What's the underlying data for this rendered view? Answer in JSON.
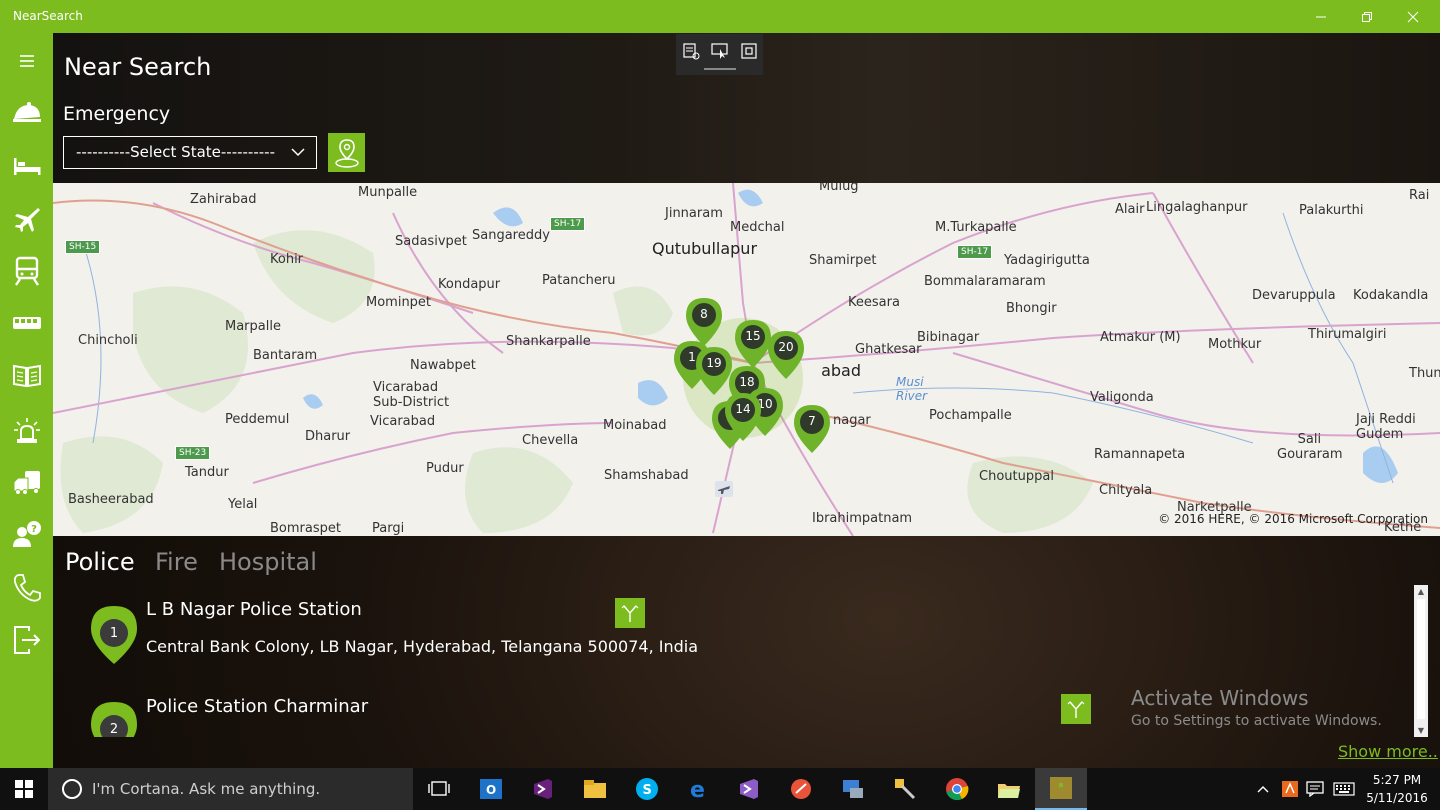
{
  "window": {
    "title": "NearSearch",
    "controls": [
      "minimize",
      "maximize",
      "close"
    ]
  },
  "sidebar": {
    "items": [
      {
        "name": "menu",
        "icon": "hamburger-icon"
      },
      {
        "name": "restaurant",
        "icon": "food-cover-icon"
      },
      {
        "name": "hotel",
        "icon": "bed-icon"
      },
      {
        "name": "airport",
        "icon": "airplane-icon"
      },
      {
        "name": "train",
        "icon": "train-icon"
      },
      {
        "name": "bus",
        "icon": "bus-icon"
      },
      {
        "name": "library",
        "icon": "book-icon"
      },
      {
        "name": "emergency",
        "icon": "siren-icon"
      },
      {
        "name": "transport",
        "icon": "vehicles-icon"
      },
      {
        "name": "help",
        "icon": "person-question-icon"
      },
      {
        "name": "contact",
        "icon": "phone-icon"
      },
      {
        "name": "exit",
        "icon": "exit-icon"
      }
    ]
  },
  "header": {
    "title": "Near Search",
    "section": "Emergency",
    "state_select": "----------Select State----------"
  },
  "map": {
    "copyright": "© 2016 HERE, © 2016 Microsoft Corporation",
    "labels": {
      "zahirabad": "Zahirabad",
      "munpalle": "Munpalle",
      "mulug": "Mulug",
      "jinnaram": "Jinnaram",
      "medchal": "Medchal",
      "mturkapalle": "M.Turkapalle",
      "alair": "Alair",
      "lingalaghanpur": "Lingalaghanpur",
      "palakurthi": "Palakurthi",
      "rai": "Rai",
      "sadasivpet": "Sadasivpet",
      "sangareddy": "Sangareddy",
      "qutubullapur": "Qutubullapur",
      "shamirpet": "Shamirpet",
      "yadagirigutta": "Yadagirigutta",
      "kohir": "Kohir",
      "kondapur": "Kondapur",
      "patancheru": "Patancheru",
      "bommalaramaram": "Bommalaramaram",
      "devaruppula": "Devaruppula",
      "kodakandla": "Kodakandla",
      "mominpet": "Mominpet",
      "keesara": "Keesara",
      "bhongir": "Bhongir",
      "marpalle": "Marpalle",
      "chincholi": "Chincholi",
      "shankarpalle": "Shankarpalle",
      "bibinagar": "Bibinagar",
      "atmakur": "Atmakur (M)",
      "mothkur": "Mothkur",
      "thirumalgiri": "Thirumalgiri",
      "bantaram": "Bantaram",
      "ghatkesar": "Ghatkesar",
      "nawabpet": "Nawabpet",
      "hyderabad": "Hyderabad",
      "thungathurthi": "Thunga",
      "vicarabad_sub": "Vicarabad\nSub-District",
      "musi_river": "Musi\nRiver",
      "valigonda": "Valigonda",
      "peddemul": "Peddemul",
      "vicarabad": "Vicarabad",
      "moinabad": "Moinabad",
      "pochampalle": "Pochampalle",
      "jaji_reddi": "Jaji Reddi\nGudem",
      "dharur": "Dharur",
      "chevella": "Chevella",
      "lb_nagar": "nagar",
      "sali_gouraram": "Sali\nGouraram",
      "tandur": "Tandur",
      "pudur": "Pudur",
      "ramannapeta": "Ramannapeta",
      "shamshabad": "Shamshabad",
      "choutuppal": "Choutuppal",
      "basheerabad": "Basheerabad",
      "yelal": "Yelal",
      "chityala": "Chityala",
      "narketpalle": "Narketpalle",
      "bomraspet": "Bomraspet",
      "pargi": "Pargi",
      "ibrahimpatnam": "Ibrahimpatnam",
      "kethe": "Kethe"
    },
    "shields": [
      "SH-15",
      "SH-17",
      "SH-17",
      "SH-23"
    ],
    "pins": [
      "8",
      "15",
      "20",
      "19",
      "18",
      "14",
      "10",
      "7",
      "1",
      "9"
    ]
  },
  "tabs": [
    {
      "label": "Police",
      "active": true
    },
    {
      "label": "Fire",
      "active": false
    },
    {
      "label": "Hospital",
      "active": false
    }
  ],
  "results": [
    {
      "index": "1",
      "name": "L B Nagar Police Station",
      "address": "Central Bank Colony, LB Nagar, Hyderabad, Telangana 500074, India"
    },
    {
      "index": "2",
      "name": "Police Station Charminar",
      "address": ""
    }
  ],
  "overlay": {
    "activate_title": "Activate Windows",
    "activate_sub": "Go to Settings to activate Windows.",
    "show_more": "Show more.."
  },
  "taskbar": {
    "search_placeholder": "I'm Cortana. Ask me anything.",
    "apps": [
      "task-view-icon",
      "outlook-icon",
      "visual-studio-icon",
      "file-explorer-icon",
      "skype-icon",
      "edge-icon",
      "visual-studio-purple-icon",
      "app-red-icon",
      "app-network-icon",
      "app-tools-icon",
      "chrome-icon",
      "folder-icon",
      "nearsearch-icon"
    ],
    "time": "5:27 PM",
    "date": "5/11/2016"
  },
  "colors": {
    "accent": "#7cbc1f",
    "taskbar": "#101010",
    "cortana_bg": "#2b2b2b"
  }
}
